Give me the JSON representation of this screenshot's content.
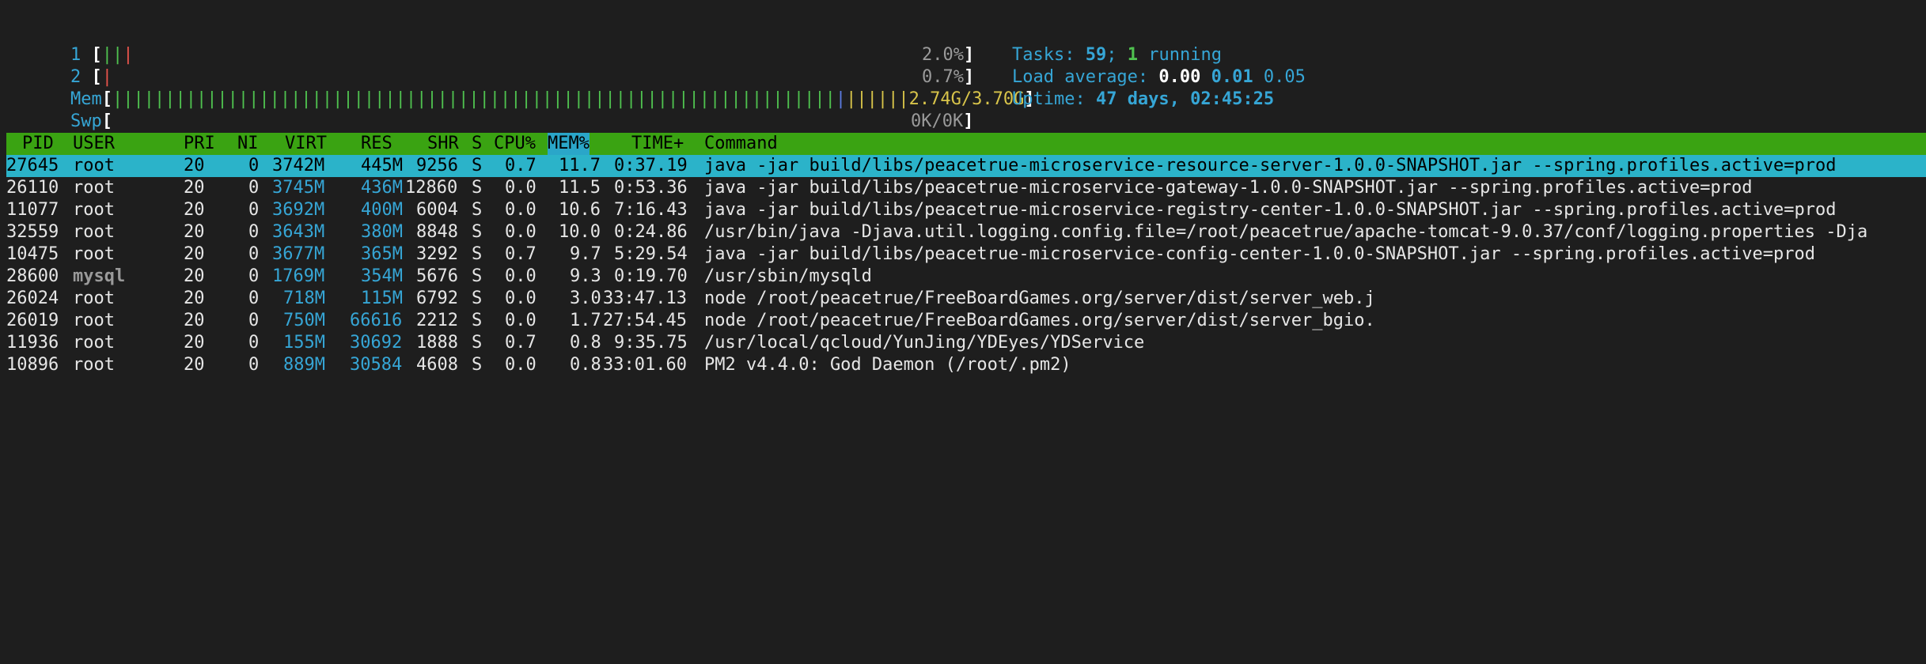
{
  "meters": {
    "cpu1": {
      "label": "1",
      "value": "2.0%"
    },
    "cpu2": {
      "label": "2",
      "value": "0.7%"
    },
    "mem": {
      "label": "Mem",
      "value": "2.74G/3.70G"
    },
    "swp": {
      "label": "Swp",
      "value": "0K/0K"
    }
  },
  "info": {
    "tasks_label": "Tasks:",
    "tasks_count": "59",
    "tasks_sep": ";",
    "running_count": "1",
    "running_label": "running",
    "load_label": "Load average:",
    "load1": "0.00",
    "load5": "0.01",
    "load15": "0.05",
    "uptime_label": "Uptime:",
    "uptime_value": "47 days, 02:45:25"
  },
  "columns": [
    "PID",
    "USER",
    "PRI",
    "NI",
    "VIRT",
    "RES",
    "SHR",
    "S",
    "CPU%",
    "MEM%",
    "TIME+",
    "Command"
  ],
  "processes": [
    {
      "pid": "27645",
      "user": "root",
      "pri": "20",
      "ni": "0",
      "virt": "3742M",
      "res": "445M",
      "shr": "9256",
      "s": "S",
      "cpu": "0.7",
      "mem": "11.7",
      "time": "0:37.19",
      "cmd": "java -jar build/libs/peacetrue-microservice-resource-server-1.0.0-SNAPSHOT.jar --spring.profiles.active=prod"
    },
    {
      "pid": "26110",
      "user": "root",
      "pri": "20",
      "ni": "0",
      "virt": "3745M",
      "res": "436M",
      "shr": "12860",
      "s": "S",
      "cpu": "0.0",
      "mem": "11.5",
      "time": "0:53.36",
      "cmd": "java -jar build/libs/peacetrue-microservice-gateway-1.0.0-SNAPSHOT.jar --spring.profiles.active=prod"
    },
    {
      "pid": "11077",
      "user": "root",
      "pri": "20",
      "ni": "0",
      "virt": "3692M",
      "res": "400M",
      "shr": "6004",
      "s": "S",
      "cpu": "0.0",
      "mem": "10.6",
      "time": "7:16.43",
      "cmd": "java -jar build/libs/peacetrue-microservice-registry-center-1.0.0-SNAPSHOT.jar --spring.profiles.active=prod"
    },
    {
      "pid": "32559",
      "user": "root",
      "pri": "20",
      "ni": "0",
      "virt": "3643M",
      "res": "380M",
      "shr": "8848",
      "s": "S",
      "cpu": "0.0",
      "mem": "10.0",
      "time": "0:24.86",
      "cmd": "/usr/bin/java -Djava.util.logging.config.file=/root/peacetrue/apache-tomcat-9.0.37/conf/logging.properties -Dja"
    },
    {
      "pid": "10475",
      "user": "root",
      "pri": "20",
      "ni": "0",
      "virt": "3677M",
      "res": "365M",
      "shr": "3292",
      "s": "S",
      "cpu": "0.7",
      "mem": "9.7",
      "time": "5:29.54",
      "cmd": "java -jar build/libs/peacetrue-microservice-config-center-1.0.0-SNAPSHOT.jar --spring.profiles.active=prod"
    },
    {
      "pid": "28600",
      "user": "mysql",
      "pri": "20",
      "ni": "0",
      "virt": "1769M",
      "res": "354M",
      "shr": "5676",
      "s": "S",
      "cpu": "0.0",
      "mem": "9.3",
      "time": "0:19.70",
      "cmd": "/usr/sbin/mysqld"
    },
    {
      "pid": "26024",
      "user": "root",
      "pri": "20",
      "ni": "0",
      "virt": "718M",
      "res": "115M",
      "shr": "6792",
      "s": "S",
      "cpu": "0.0",
      "mem": "3.0",
      "time": "33:47.13",
      "cmd": "node /root/peacetrue/FreeBoardGames.org/server/dist/server_web.j"
    },
    {
      "pid": "26019",
      "user": "root",
      "pri": "20",
      "ni": "0",
      "virt": "750M",
      "res": "66616",
      "shr": "2212",
      "s": "S",
      "cpu": "0.0",
      "mem": "1.7",
      "time": "27:54.45",
      "cmd": "node /root/peacetrue/FreeBoardGames.org/server/dist/server_bgio."
    },
    {
      "pid": "11936",
      "user": "root",
      "pri": "20",
      "ni": "0",
      "virt": "155M",
      "res": "30692",
      "shr": "1888",
      "s": "S",
      "cpu": "0.7",
      "mem": "0.8",
      "time": "9:35.75",
      "cmd": "/usr/local/qcloud/YunJing/YDEyes/YDService"
    },
    {
      "pid": "10896",
      "user": "root",
      "pri": "20",
      "ni": "0",
      "virt": "889M",
      "res": "30584",
      "shr": "4608",
      "s": "S",
      "cpu": "0.0",
      "mem": "0.8",
      "time": "33:01.60",
      "cmd": "PM2 v4.4.0: God Daemon (/root/.pm2)"
    }
  ]
}
